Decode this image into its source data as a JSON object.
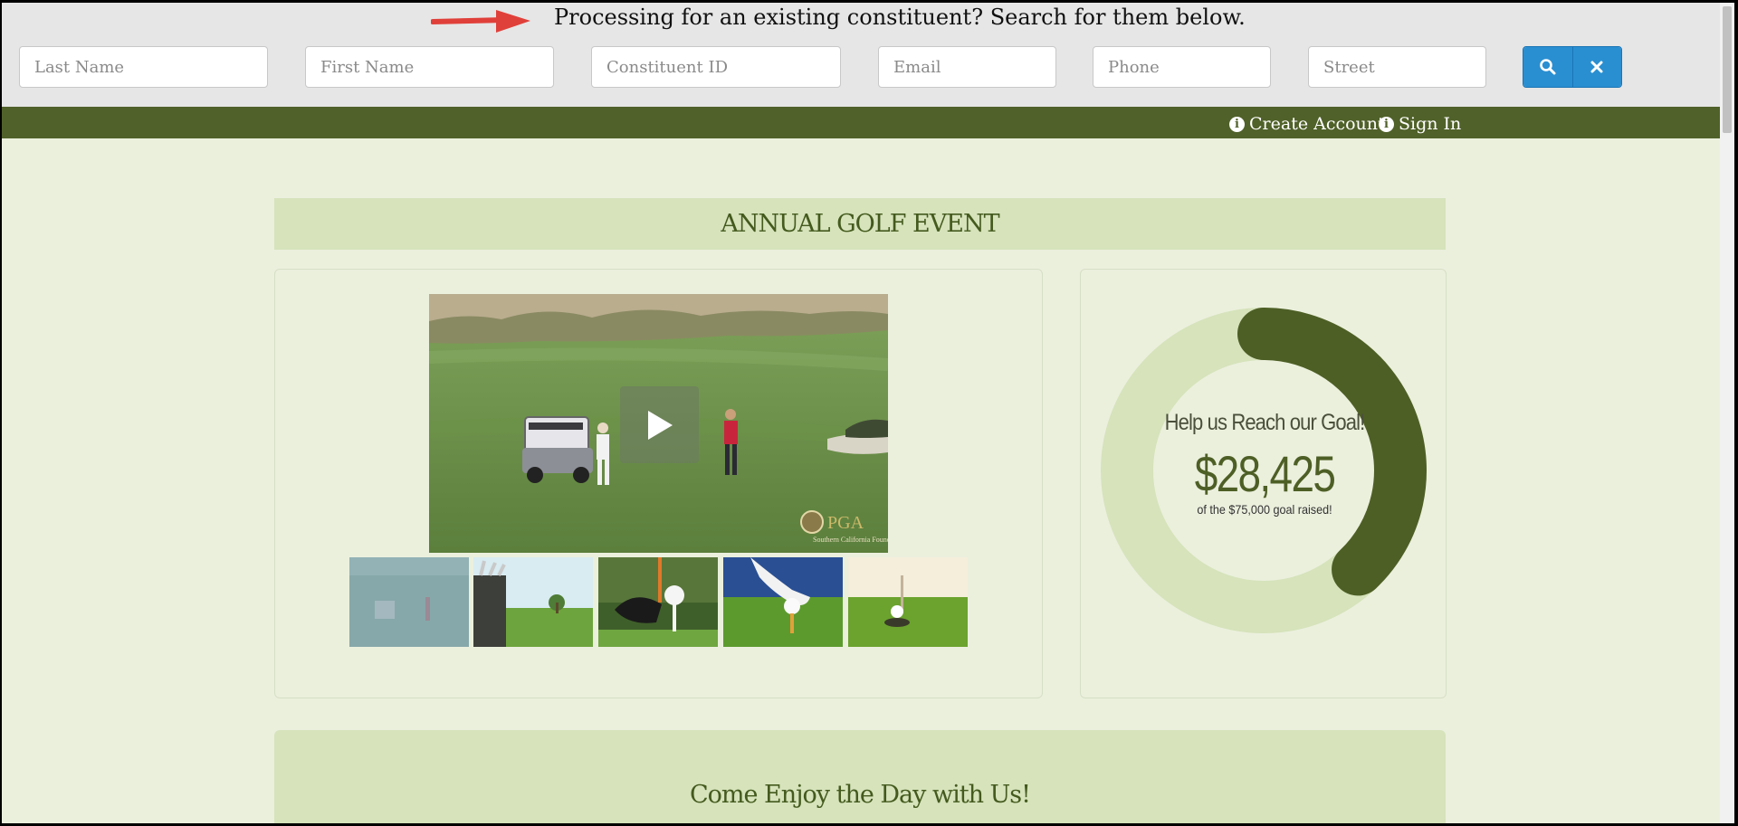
{
  "search": {
    "heading": "Processing for an existing constituent? Search for them below.",
    "fields": {
      "last_name": "Last Name",
      "first_name": "First Name",
      "constituent_id": "Constituent ID",
      "email": "Email",
      "phone": "Phone",
      "street": "Street"
    },
    "search_icon": "search-icon",
    "clear_icon": "close-icon"
  },
  "nav": {
    "create_account": "Create Account",
    "sign_in": "Sign In",
    "icon": "info-circle-icon"
  },
  "event": {
    "title": "ANNUAL GOLF EVENT",
    "video_logo": "PGA",
    "video_logo_sub": "Southern California Foundation",
    "thumbnails": [
      {
        "subject": "golf-course-cart"
      },
      {
        "subject": "golf-bag-clubs"
      },
      {
        "subject": "driver-ball-tee"
      },
      {
        "subject": "gloved-hand-ball"
      },
      {
        "subject": "ball-near-hole"
      }
    ]
  },
  "goal": {
    "heading": "Help us Reach our Goal!",
    "raised": "$28,425",
    "subtext": "of the $75,000 goal raised!",
    "raised_value": 28425,
    "goal_value": 75000,
    "progress_fraction": 0.379
  },
  "section2": {
    "title": "Come Enjoy the Day with Us!"
  },
  "colors": {
    "nav_green": "#506129",
    "page_bg": "#ebf0dd",
    "band_green": "#d6e3bb",
    "ring_track": "#d6e3bb",
    "ring_fill": "#4e5f26",
    "button_blue": "#2a8fd1"
  }
}
